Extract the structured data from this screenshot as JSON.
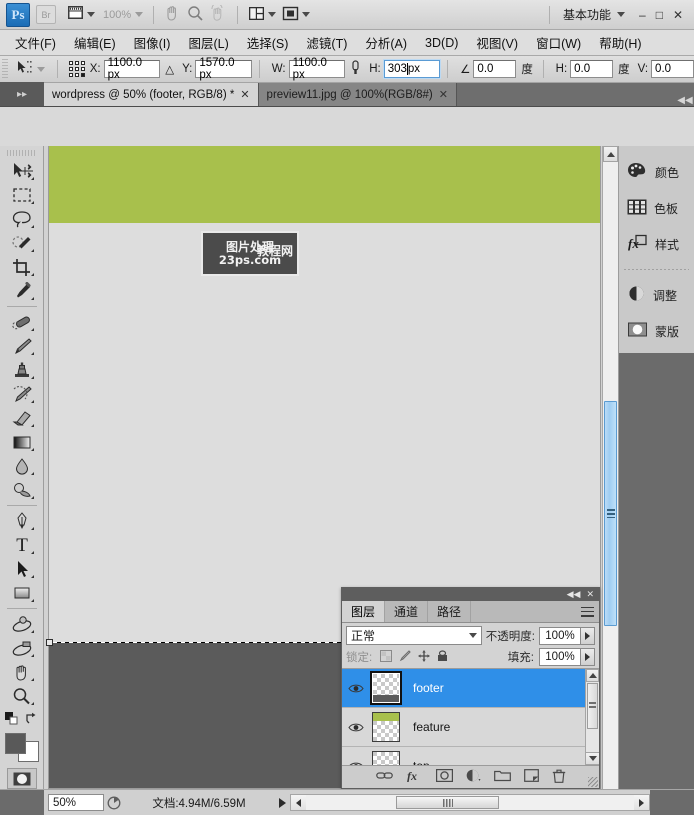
{
  "app": {
    "logo": "Ps",
    "bridge_label": "Br",
    "zoom_level": "100%",
    "workspace": "基本功能",
    "window_minimize": "–",
    "window_maximize": "□",
    "window_close": "✕"
  },
  "menubar": {
    "items": [
      {
        "label": "文件(F)",
        "name": "menu-file"
      },
      {
        "label": "编辑(E)",
        "name": "menu-edit"
      },
      {
        "label": "图像(I)",
        "name": "menu-image"
      },
      {
        "label": "图层(L)",
        "name": "menu-layer"
      },
      {
        "label": "选择(S)",
        "name": "menu-select"
      },
      {
        "label": "滤镜(T)",
        "name": "menu-filter"
      },
      {
        "label": "分析(A)",
        "name": "menu-analysis"
      },
      {
        "label": "3D(D)",
        "name": "menu-3d"
      },
      {
        "label": "视图(V)",
        "name": "menu-view"
      },
      {
        "label": "窗口(W)",
        "name": "menu-window"
      },
      {
        "label": "帮助(H)",
        "name": "menu-help"
      }
    ]
  },
  "options_bar": {
    "x_label": "X:",
    "x_value": "1100.0 px",
    "delta_symbol": "△",
    "y_label": "Y:",
    "y_value": "1570.0 px",
    "w_label": "W:",
    "w_value": "1100.0 px",
    "link_symbol": "⛓",
    "h_label": "H:",
    "h_value": "303",
    "h_suffix": "px",
    "angle_symbol": "∠",
    "angle_value": "0.0",
    "degree_label": "度",
    "skew_h_label": "H:",
    "skew_h_value": "0.0",
    "degree_label2": "度",
    "skew_v_label": "V:",
    "skew_v_value": "0.0"
  },
  "tabs": {
    "items": [
      {
        "label": "wordpress @ 50% (footer, RGB/8) *",
        "active": true,
        "name": "tab-wordpress"
      },
      {
        "label": "preview11.jpg @ 100%(RGB/8#)",
        "active": false,
        "name": "tab-preview11"
      }
    ],
    "close_glyph": "✕"
  },
  "toolbox": {
    "tools": [
      {
        "name": "move-tool",
        "title": "移动工具"
      },
      {
        "name": "rectangular-marquee-tool",
        "title": "矩形选框工具"
      },
      {
        "name": "lasso-tool",
        "title": "套索工具"
      },
      {
        "name": "quick-selection-tool",
        "title": "快速选择工具"
      },
      {
        "name": "crop-tool",
        "title": "裁剪工具"
      },
      {
        "name": "eyedropper-tool",
        "title": "吸管工具"
      },
      {
        "name": "spot-healing-brush-tool",
        "title": "污点修复画笔工具"
      },
      {
        "name": "brush-tool",
        "title": "画笔工具"
      },
      {
        "name": "clone-stamp-tool",
        "title": "仿制图章工具"
      },
      {
        "name": "history-brush-tool",
        "title": "历史记录画笔工具"
      },
      {
        "name": "eraser-tool",
        "title": "橡皮擦工具"
      },
      {
        "name": "gradient-tool",
        "title": "渐变工具"
      },
      {
        "name": "blur-tool",
        "title": "模糊工具"
      },
      {
        "name": "dodge-tool",
        "title": "减淡工具"
      },
      {
        "name": "pen-tool",
        "title": "钢笔工具"
      },
      {
        "name": "type-tool",
        "title": "横排文字工具"
      },
      {
        "name": "path-selection-tool",
        "title": "路径选择工具"
      },
      {
        "name": "rectangle-tool",
        "title": "矩形工具"
      },
      {
        "name": "rotate-3d-object-tool",
        "title": "3D对象旋转工具"
      },
      {
        "name": "rotate-3d-camera-tool",
        "title": "3D相机旋转工具"
      },
      {
        "name": "hand-tool",
        "title": "抓手工具"
      },
      {
        "name": "zoom-tool",
        "title": "缩放工具"
      }
    ],
    "foreground_color": "#595959",
    "background_color": "#ffffff"
  },
  "canvas": {
    "watermark_line1": "图片处理",
    "watermark_line2": "23ps.com",
    "watermark_overlay": "教程网",
    "band_green_color": "#a8c04c",
    "band_gray_color": "#dddddd",
    "band_dark_color": "#5b5b5b"
  },
  "dock": {
    "groups": [
      {
        "items": [
          {
            "label": "颜色",
            "name": "dock-item-color",
            "icon": "palette-icon"
          },
          {
            "label": "色板",
            "name": "dock-item-swatches",
            "icon": "swatches-icon"
          },
          {
            "label": "样式",
            "name": "dock-item-styles",
            "icon": "fx-icon"
          }
        ]
      },
      {
        "items": [
          {
            "label": "调整",
            "name": "dock-item-adjustments",
            "icon": "adjustments-icon"
          },
          {
            "label": "蒙版",
            "name": "dock-item-masks",
            "icon": "masks-icon"
          }
        ]
      }
    ]
  },
  "layers_panel": {
    "collapse_glyph": "◀◀",
    "close_glyph": "✕",
    "tabs": [
      {
        "label": "图层",
        "active": true,
        "name": "panel-tab-layers"
      },
      {
        "label": "通道",
        "active": false,
        "name": "panel-tab-channels"
      },
      {
        "label": "路径",
        "active": false,
        "name": "panel-tab-paths"
      }
    ],
    "blend_mode": "正常",
    "opacity_label": "不透明度:",
    "opacity_value": "100%",
    "lock_label": "锁定:",
    "fill_label": "填充:",
    "fill_value": "100%",
    "layers": [
      {
        "name": "footer",
        "selected": true,
        "visible": true,
        "thumb": "transparent-bottom-strip"
      },
      {
        "name": "feature",
        "selected": false,
        "visible": true,
        "thumb": "transparent-top-green"
      },
      {
        "name": "top",
        "selected": false,
        "visible": true,
        "thumb": "transparent"
      }
    ],
    "footer_buttons": [
      {
        "name": "link-layers-button",
        "icon": "link-icon"
      },
      {
        "name": "layer-style-button",
        "icon": "fx-icon"
      },
      {
        "name": "layer-mask-button",
        "icon": "mask-icon"
      },
      {
        "name": "adjustment-layer-button",
        "icon": "half-circle-icon"
      },
      {
        "name": "new-group-button",
        "icon": "folder-icon"
      },
      {
        "name": "new-layer-button",
        "icon": "new-layer-icon"
      },
      {
        "name": "delete-layer-button",
        "icon": "trash-icon"
      }
    ]
  },
  "status_bar": {
    "zoom_value": "50%",
    "doc_label": "文档:4.94M/6.59M"
  }
}
